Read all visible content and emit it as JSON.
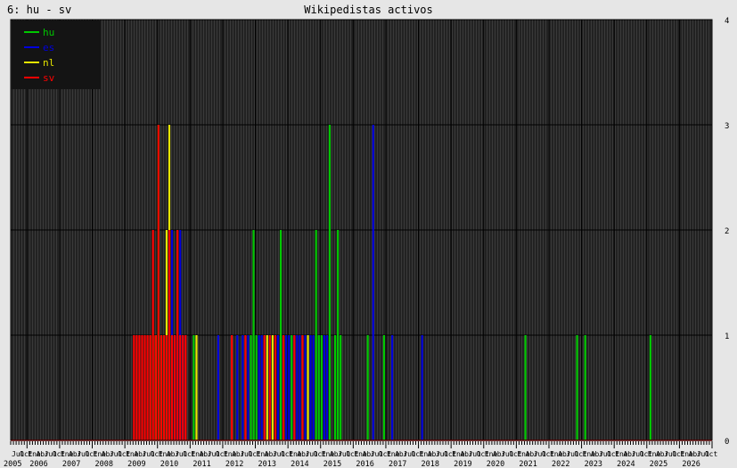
{
  "header": {
    "page_label": "6: hu - sv"
  },
  "chart_data": {
    "type": "bar",
    "title": "Wikipedistas activos",
    "xlabel": "",
    "ylabel": "",
    "ylim": [
      0,
      4
    ],
    "yticks": [
      "0",
      "1",
      "2",
      "3",
      "4"
    ],
    "grid": true,
    "legend_position": "top-left",
    "x_start": "2005-07",
    "x_end": "2026-12",
    "years": [
      "2005",
      "2006",
      "2007",
      "2008",
      "2009",
      "2010",
      "2011",
      "2012",
      "2013",
      "2014",
      "2015",
      "2016",
      "2017",
      "2018",
      "2019",
      "2020",
      "2021",
      "2022",
      "2023",
      "2024",
      "2025",
      "2026"
    ],
    "month_labels": [
      "Ene",
      "Abr",
      "Jul",
      "Oct"
    ],
    "series": [
      {
        "name": "hu",
        "color": "#00c800",
        "points": [
          [
            "2009-10",
            1
          ],
          [
            "2010-01",
            3
          ],
          [
            "2010-02",
            1
          ],
          [
            "2010-03",
            1
          ],
          [
            "2011-02",
            1
          ],
          [
            "2012-11",
            1
          ],
          [
            "2012-12",
            2
          ],
          [
            "2013-01",
            1
          ],
          [
            "2013-10",
            2
          ],
          [
            "2013-11",
            1
          ],
          [
            "2014-02",
            1
          ],
          [
            "2014-06",
            1
          ],
          [
            "2014-11",
            2
          ],
          [
            "2014-12",
            1
          ],
          [
            "2015-01",
            1
          ],
          [
            "2015-04",
            3
          ],
          [
            "2015-06",
            1
          ],
          [
            "2015-07",
            2
          ],
          [
            "2015-08",
            1
          ],
          [
            "2016-06",
            1
          ],
          [
            "2016-12",
            1
          ],
          [
            "2021-04",
            1
          ],
          [
            "2022-11",
            1
          ],
          [
            "2023-02",
            1
          ],
          [
            "2025-02",
            1
          ]
        ]
      },
      {
        "name": "es",
        "color": "#0000dc",
        "points": [
          [
            "2010-06",
            2
          ],
          [
            "2010-07",
            1
          ],
          [
            "2010-08",
            1
          ],
          [
            "2010-09",
            2
          ],
          [
            "2010-10",
            1
          ],
          [
            "2011-11",
            1
          ],
          [
            "2012-06",
            1
          ],
          [
            "2012-08",
            1
          ],
          [
            "2012-10",
            1
          ],
          [
            "2013-02",
            1
          ],
          [
            "2013-03",
            1
          ],
          [
            "2013-04",
            1
          ],
          [
            "2013-06",
            1
          ],
          [
            "2013-09",
            1
          ],
          [
            "2013-12",
            1
          ],
          [
            "2014-01",
            1
          ],
          [
            "2014-03",
            1
          ],
          [
            "2014-04",
            1
          ],
          [
            "2014-05",
            1
          ],
          [
            "2014-07",
            1
          ],
          [
            "2014-09",
            1
          ],
          [
            "2014-10",
            1
          ],
          [
            "2015-02",
            1
          ],
          [
            "2015-03",
            1
          ],
          [
            "2016-08",
            3
          ],
          [
            "2017-03",
            1
          ],
          [
            "2018-02",
            1
          ]
        ]
      },
      {
        "name": "nl",
        "color": "#e6e600",
        "points": [
          [
            "2009-12",
            1
          ],
          [
            "2010-04",
            2
          ],
          [
            "2010-05",
            3
          ],
          [
            "2011-03",
            1
          ],
          [
            "2013-05",
            1
          ],
          [
            "2013-07",
            1
          ],
          [
            "2014-08",
            1
          ]
        ]
      },
      {
        "name": "sv",
        "color": "#ff0000",
        "points": [
          [
            "2009-04",
            1
          ],
          [
            "2009-05",
            1
          ],
          [
            "2009-06",
            1
          ],
          [
            "2009-07",
            1
          ],
          [
            "2009-08",
            1
          ],
          [
            "2009-09",
            1
          ],
          [
            "2009-10",
            1
          ],
          [
            "2009-11",
            2
          ],
          [
            "2009-12",
            1
          ],
          [
            "2010-01",
            3
          ],
          [
            "2010-02",
            1
          ],
          [
            "2010-03",
            1
          ],
          [
            "2010-04",
            1
          ],
          [
            "2010-05",
            2
          ],
          [
            "2010-06",
            1
          ],
          [
            "2010-07",
            1
          ],
          [
            "2010-08",
            2
          ],
          [
            "2010-09",
            1
          ],
          [
            "2010-10",
            1
          ],
          [
            "2010-11",
            1
          ],
          [
            "2012-04",
            1
          ],
          [
            "2012-09",
            1
          ],
          [
            "2013-04",
            1
          ],
          [
            "2013-06",
            1
          ],
          [
            "2013-08",
            1
          ],
          [
            "2013-11",
            1
          ],
          [
            "2014-03",
            1
          ],
          [
            "2014-06",
            1
          ]
        ]
      }
    ]
  }
}
